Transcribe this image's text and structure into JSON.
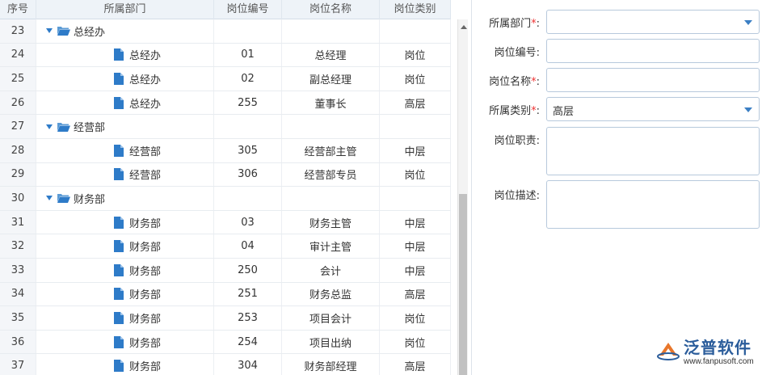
{
  "grid": {
    "headers": {
      "seq": "序号",
      "dept": "所属部门",
      "code": "岗位编号",
      "name": "岗位名称",
      "cat": "岗位类别"
    },
    "rows": [
      {
        "seq": "23",
        "type": "group",
        "dept": "总经办",
        "code": "",
        "name": "",
        "cat": ""
      },
      {
        "seq": "24",
        "type": "leaf",
        "dept": "总经办",
        "code": "01",
        "name": "总经理",
        "cat": "岗位"
      },
      {
        "seq": "25",
        "type": "leaf",
        "dept": "总经办",
        "code": "02",
        "name": "副总经理",
        "cat": "岗位"
      },
      {
        "seq": "26",
        "type": "leaf",
        "dept": "总经办",
        "code": "255",
        "name": "董事长",
        "cat": "高层"
      },
      {
        "seq": "27",
        "type": "group",
        "dept": "经营部",
        "code": "",
        "name": "",
        "cat": ""
      },
      {
        "seq": "28",
        "type": "leaf",
        "dept": "经营部",
        "code": "305",
        "name": "经营部主管",
        "cat": "中层"
      },
      {
        "seq": "29",
        "type": "leaf",
        "dept": "经营部",
        "code": "306",
        "name": "经营部专员",
        "cat": "岗位"
      },
      {
        "seq": "30",
        "type": "group",
        "dept": "财务部",
        "code": "",
        "name": "",
        "cat": ""
      },
      {
        "seq": "31",
        "type": "leaf",
        "dept": "财务部",
        "code": "03",
        "name": "财务主管",
        "cat": "中层"
      },
      {
        "seq": "32",
        "type": "leaf",
        "dept": "财务部",
        "code": "04",
        "name": "审计主管",
        "cat": "中层"
      },
      {
        "seq": "33",
        "type": "leaf",
        "dept": "财务部",
        "code": "250",
        "name": "会计",
        "cat": "中层"
      },
      {
        "seq": "34",
        "type": "leaf",
        "dept": "财务部",
        "code": "251",
        "name": "财务总监",
        "cat": "高层"
      },
      {
        "seq": "35",
        "type": "leaf",
        "dept": "财务部",
        "code": "253",
        "name": "项目会计",
        "cat": "岗位"
      },
      {
        "seq": "36",
        "type": "leaf",
        "dept": "财务部",
        "code": "254",
        "name": "项目出纳",
        "cat": "岗位"
      },
      {
        "seq": "37",
        "type": "leaf",
        "dept": "财务部",
        "code": "304",
        "name": "财务部经理",
        "cat": "高层"
      }
    ]
  },
  "form": {
    "dept_label": "所属部门",
    "code_label": "岗位编号:",
    "name_label": "岗位名称",
    "cat_label": "所属类别",
    "cat_value": "高层",
    "duty_label": "岗位职责:",
    "desc_label": "岗位描述:",
    "required_mark": "*",
    "colon": ":"
  },
  "logo": {
    "name": "泛普软件",
    "url": "www.fanpusoft.com"
  },
  "colors": {
    "accent": "#2e7bc8",
    "required": "#ee3333",
    "header_bg": "#eef3f8"
  }
}
